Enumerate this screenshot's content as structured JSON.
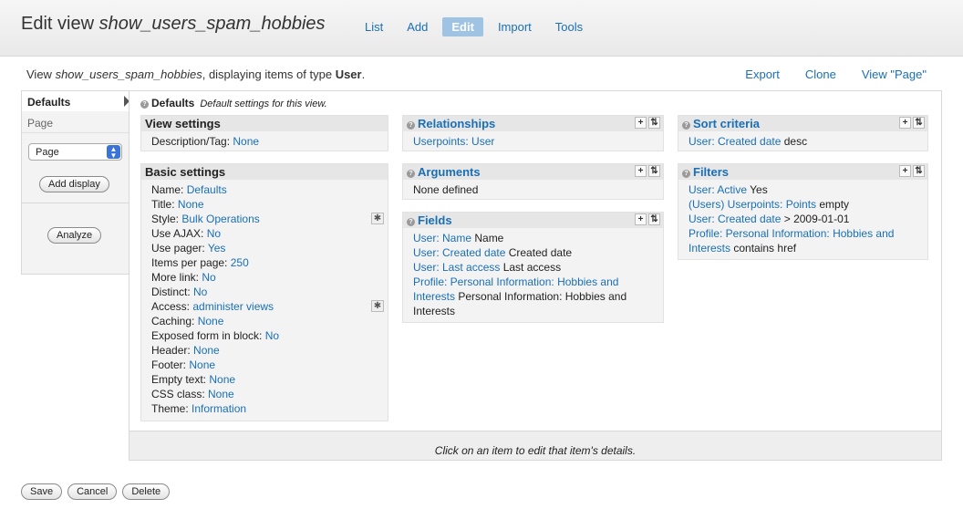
{
  "header": {
    "title_prefix": "Edit view ",
    "title_name": "show_users_spam_hobbies",
    "tabs": [
      "List",
      "Add",
      "Edit",
      "Import",
      "Tools"
    ]
  },
  "subline": {
    "prefix": "View ",
    "name": "show_users_spam_hobbies",
    "middle": ", displaying items of type ",
    "type": "User",
    "suffix": "."
  },
  "sublinks": [
    "Export",
    "Clone",
    "View \"Page\""
  ],
  "sidebar": {
    "defaults": "Defaults",
    "page": "Page",
    "select_value": "Page",
    "add_display": "Add display",
    "analyze": "Analyze"
  },
  "main": {
    "head_title": "Defaults",
    "head_desc": "Default settings for this view.",
    "footer": "Click on an item to edit that item's details."
  },
  "view_settings": {
    "title": "View settings",
    "rows": [
      {
        "label": "Description/Tag: ",
        "value": "None"
      }
    ]
  },
  "basic_settings": {
    "title": "Basic settings",
    "rows": [
      {
        "label": "Name: ",
        "value": "Defaults"
      },
      {
        "label": "Title: ",
        "value": "None"
      },
      {
        "label": "Style: ",
        "value": "Bulk Operations",
        "gear": true
      },
      {
        "label": "Use AJAX: ",
        "value": "No"
      },
      {
        "label": "Use pager: ",
        "value": "Yes"
      },
      {
        "label": "Items per page: ",
        "value": "250"
      },
      {
        "label": "More link: ",
        "value": "No"
      },
      {
        "label": "Distinct: ",
        "value": "No"
      },
      {
        "label": "Access: ",
        "value": "administer views",
        "gear": true
      },
      {
        "label": "Caching: ",
        "value": "None"
      },
      {
        "label": "Exposed form in block: ",
        "value": "No"
      },
      {
        "label": "Header: ",
        "value": "None"
      },
      {
        "label": "Footer: ",
        "value": "None"
      },
      {
        "label": "Empty text: ",
        "value": "None"
      },
      {
        "label": "CSS class: ",
        "value": "None"
      },
      {
        "label": "Theme: ",
        "value": "Information"
      }
    ]
  },
  "relationships": {
    "title": "Relationships",
    "rows": [
      {
        "link": "Userpoints: User",
        "text": ""
      }
    ]
  },
  "arguments": {
    "title": "Arguments",
    "rows": [
      {
        "link": "",
        "text": "None defined"
      }
    ]
  },
  "fields": {
    "title": "Fields",
    "rows": [
      {
        "link": "User: Name",
        "text": " Name"
      },
      {
        "link": "User: Created date",
        "text": " Created date"
      },
      {
        "link": "User: Last access",
        "text": " Last access"
      },
      {
        "link": "Profile: Personal Information: Hobbies and",
        "text": ""
      },
      {
        "link": "Interests",
        "text": " Personal Information: Hobbies and"
      },
      {
        "link": "",
        "text": "Interests"
      }
    ]
  },
  "sort_criteria": {
    "title": "Sort criteria",
    "rows": [
      {
        "link": "User: Created date",
        "text": " desc"
      }
    ]
  },
  "filters": {
    "title": "Filters",
    "rows": [
      {
        "link": "User: Active",
        "text": " Yes"
      },
      {
        "link": "(Users) Userpoints: Points",
        "text": " empty"
      },
      {
        "link": "User: Created date",
        "text": " > 2009-01-01"
      },
      {
        "link": "Profile: Personal Information: Hobbies and",
        "text": ""
      },
      {
        "link": "Interests",
        "text": " contains href"
      }
    ]
  },
  "actions": [
    "Save",
    "Cancel",
    "Delete"
  ],
  "colors": {
    "link": "#1a6fb5",
    "active_tab": "#9fc3e3"
  }
}
